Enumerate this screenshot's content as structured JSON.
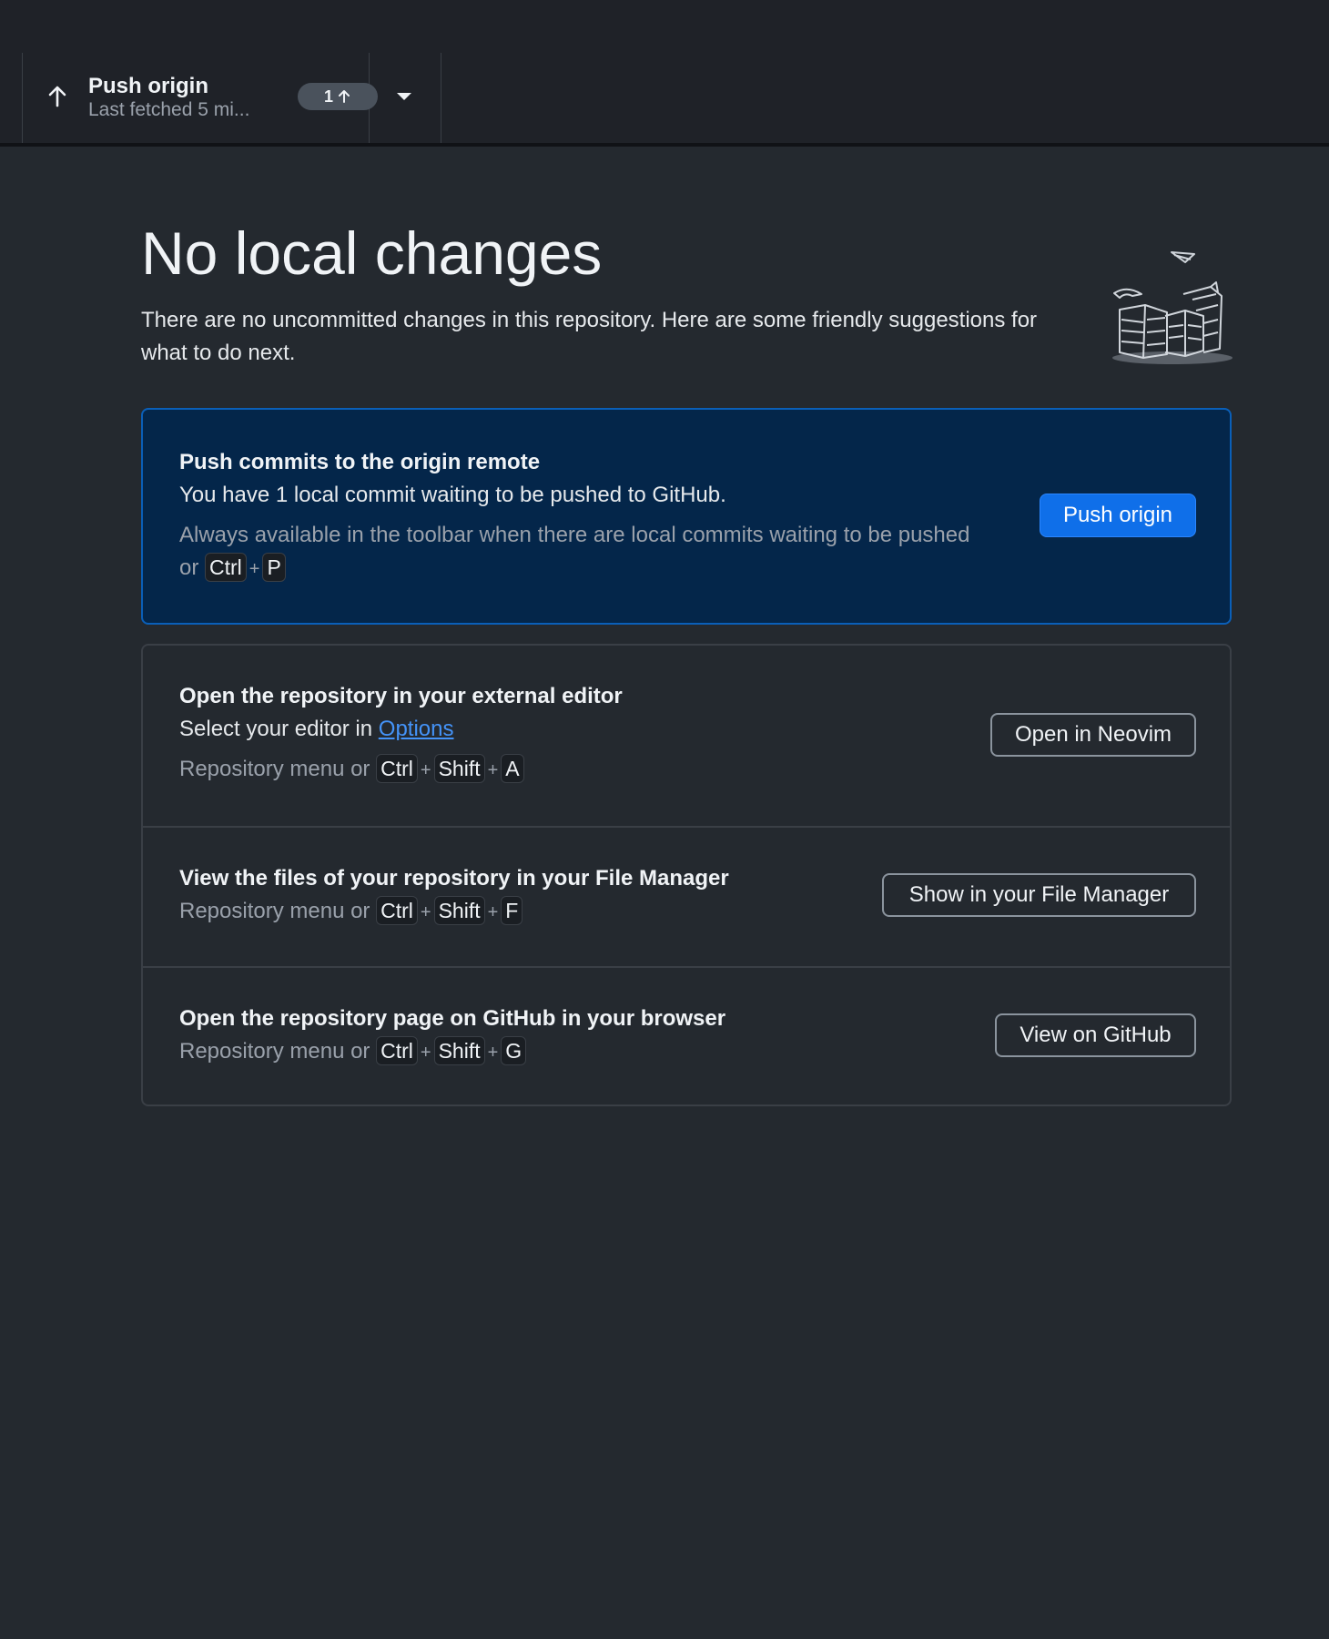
{
  "toolbar": {
    "push": {
      "title": "Push origin",
      "subtitle": "Last fetched 5 mi...",
      "badge_count": "1",
      "icon": "arrow-up-icon"
    },
    "dropdown_icon": "caret-down-icon"
  },
  "hero": {
    "title": "No local changes",
    "description": "There are no uncommitted changes in this repository. Here are some friendly suggestions for what to do next.",
    "illustration": "paper-stacks-illustration"
  },
  "primary_action": {
    "title": "Push commits to the origin remote",
    "description": "You have 1 local commit waiting to be pushed to GitHub.",
    "hint": "Always available in the toolbar when there are local commits waiting to be pushed or",
    "keys": [
      "Ctrl",
      "P"
    ],
    "button_label": "Push origin"
  },
  "actions": [
    {
      "title": "Open the repository in your external editor",
      "description_prefix": "Select your editor in",
      "description_link": "Options",
      "hint": "Repository menu or",
      "keys": [
        "Ctrl",
        "Shift",
        "A"
      ],
      "button_label": "Open in Neovim"
    },
    {
      "title": "View the files of your repository in your File Manager",
      "hint": "Repository menu or",
      "keys": [
        "Ctrl",
        "Shift",
        "F"
      ],
      "button_label": "Show in your File Manager"
    },
    {
      "title": "Open the repository page on GitHub in your browser",
      "hint": "Repository menu or",
      "keys": [
        "Ctrl",
        "Shift",
        "G"
      ],
      "button_label": "View on GitHub"
    }
  ],
  "plus_sign": "+",
  "colors": {
    "background": "#24292f",
    "toolbar": "#1f2228",
    "primary_card": "#04264a",
    "accent": "#0f6fe9",
    "link": "#4493f8"
  }
}
